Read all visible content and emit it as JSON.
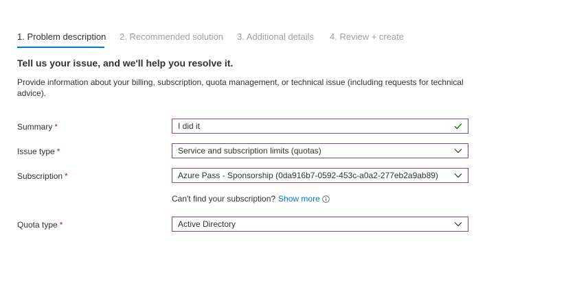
{
  "wizard": {
    "tabs": [
      {
        "label": "1. Problem description"
      },
      {
        "label": "2. Recommended solution"
      },
      {
        "label": "3. Additional details"
      },
      {
        "label": "4. Review + create"
      }
    ]
  },
  "heading": "Tell us your issue, and we'll help you resolve it.",
  "description": "Provide information about your billing, subscription, quota management, or technical issue (including requests for technical advice).",
  "form": {
    "required_mark": "*",
    "summary": {
      "label": "Summary",
      "value": "I did it"
    },
    "issue_type": {
      "label": "Issue type",
      "value": "Service and subscription limits (quotas)"
    },
    "subscription": {
      "label": "Subscription",
      "value": "Azure Pass - Sponsorship (0da916b7-0592-453c-a0a2-277eb2a9ab89)"
    },
    "subscription_help": {
      "text": "Can't find your subscription?",
      "link": "Show more"
    },
    "quota_type": {
      "label": "Quota type",
      "value": "Active Directory"
    }
  },
  "colors": {
    "accent": "#0078d4",
    "field_border": "#8a3ea8",
    "required": "#a4262c",
    "valid_check": "#107c10"
  },
  "icons": {
    "summary_status": "checkmark-icon",
    "dropdown": "chevron-down-icon",
    "info": "info-icon"
  }
}
